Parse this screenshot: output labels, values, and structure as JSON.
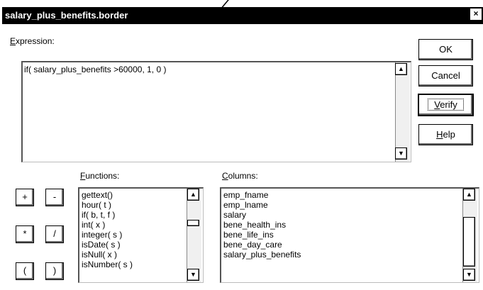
{
  "window": {
    "title": "salary_plus_benefits.border",
    "close_glyph": "×"
  },
  "expression": {
    "label_prefix": "E",
    "label_rest": "xpression:",
    "value": "if( salary_plus_benefits >60000, 1, 0 )"
  },
  "buttons": {
    "ok": "OK",
    "cancel": "Cancel",
    "verify_prefix": "V",
    "verify_rest": "erify",
    "help_prefix": "H",
    "help_rest": "elp"
  },
  "operators": [
    "+",
    "-",
    "*",
    "/",
    "(",
    ")"
  ],
  "functions": {
    "label_prefix": "F",
    "label_rest": "unctions:",
    "items": [
      "gettext()",
      "hour( t )",
      "if( b, t, f )",
      "int( x )",
      "integer( s )",
      "isDate( s )",
      "isNull( x )",
      "isNumber( s )"
    ]
  },
  "columns": {
    "label_prefix": "C",
    "label_rest": "olumns:",
    "items": [
      "emp_fname",
      "emp_lname",
      "salary",
      "bene_health_ins",
      "bene_life_ins",
      "bene_day_care",
      "salary_plus_benefits"
    ]
  },
  "icons": {
    "up": "up-arrow-icon",
    "down": "down-arrow-icon"
  }
}
